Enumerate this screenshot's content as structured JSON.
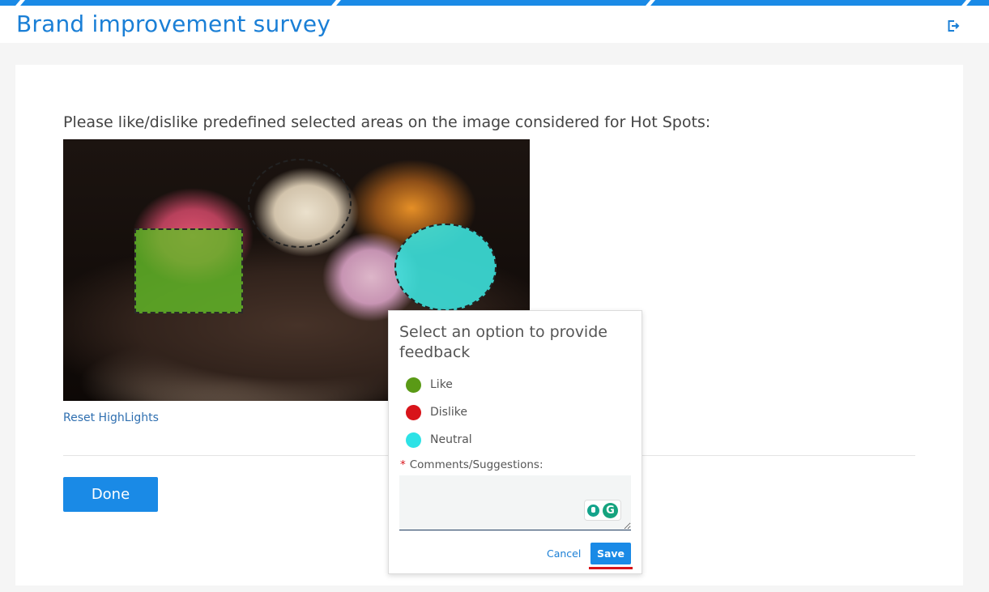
{
  "header": {
    "title": "Brand improvement survey",
    "exit_icon": "exit-icon"
  },
  "survey": {
    "instruction": "Please like/dislike predefined selected areas on the image considered for Hot Spots:",
    "image_description_icon": "ice-cream-bowl-photo",
    "reset_label": "Reset HighLights",
    "done_label": "Done"
  },
  "feedback_popup": {
    "title": "Select an option to provide feedback",
    "options": [
      {
        "label": "Like",
        "color": "#5a9a16"
      },
      {
        "label": "Dislike",
        "color": "#d8141a"
      },
      {
        "label": "Neutral",
        "color": "#2de2e6"
      }
    ],
    "required_marker": "*",
    "comments_label": "Comments/Suggestions:",
    "comments_value": "",
    "cancel_label": "Cancel",
    "save_label": "Save"
  },
  "colors": {
    "accent": "#1a8ae6",
    "title": "#1a7fd6",
    "like": "#5a9a16",
    "dislike": "#d8141a",
    "neutral": "#2de2e6",
    "required": "#d8141a"
  }
}
